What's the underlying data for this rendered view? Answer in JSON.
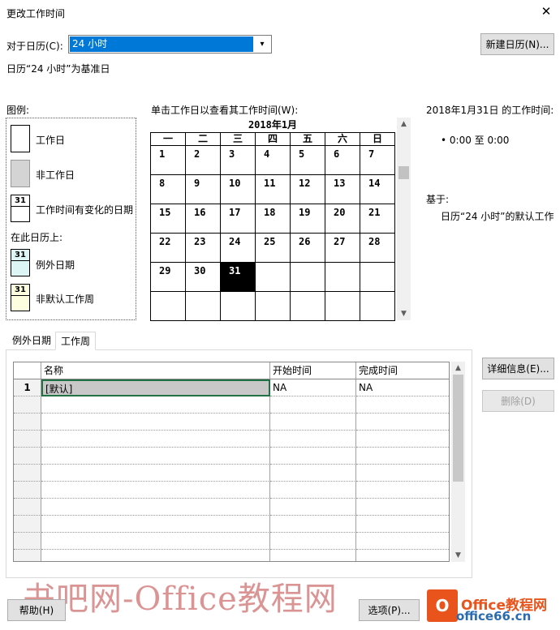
{
  "window": {
    "title": "更改工作时间"
  },
  "calendar_for": {
    "label": "对于日历(C):",
    "value": "24 小时"
  },
  "new_calendar_button": "新建日历(N)...",
  "base_calendar_note": "日历“24 小时”为基准日",
  "legend": {
    "title": "图例:",
    "working": "工作日",
    "nonworking": "非工作日",
    "changed": "工作时间有变化的日期",
    "on_this_calendar": "在此日历上:",
    "exception": "例外日期",
    "nondefault_week": "非默认工作周",
    "swatch_number": "31"
  },
  "calendar": {
    "instruction": "单击工作日以查看其工作时间(W):",
    "month_title": "2018年1月",
    "weekdays": [
      "一",
      "二",
      "三",
      "四",
      "五",
      "六",
      "日"
    ],
    "days": [
      "1",
      "2",
      "3",
      "4",
      "5",
      "6",
      "7",
      "8",
      "9",
      "10",
      "11",
      "12",
      "13",
      "14",
      "15",
      "16",
      "17",
      "18",
      "19",
      "20",
      "21",
      "22",
      "23",
      "24",
      "25",
      "26",
      "27",
      "28",
      "29",
      "30",
      "31",
      "",
      "",
      "",
      "",
      "",
      "",
      "",
      "",
      "",
      "",
      ""
    ],
    "selected_day": "31"
  },
  "work_time": {
    "heading": "2018年1月31日 的工作时间:",
    "entry": "• 0:00 至 0:00",
    "based_on_label": "基于:",
    "based_on_value": "日历“24 小时”的默认工作"
  },
  "tabs": [
    "例外日期",
    "工作周"
  ],
  "table": {
    "columns": [
      "",
      "名称",
      "开始时间",
      "完成时间"
    ],
    "rows": [
      [
        "1",
        "[默认]",
        "NA",
        "NA"
      ]
    ]
  },
  "details_button": "详细信息(E)...",
  "delete_button": "删除(D)",
  "help_button": "帮助(H)",
  "options_button": "选项(P)...",
  "watermark": "书吧网-Office教程网",
  "brand": {
    "logo": "O",
    "line1": "Office教程网",
    "line2": "office66.cn"
  },
  "colors": {
    "accent": "#0078d7",
    "selected_day": "#000000",
    "cell_select_border": "#217346",
    "watermark": "#be3c3c"
  }
}
